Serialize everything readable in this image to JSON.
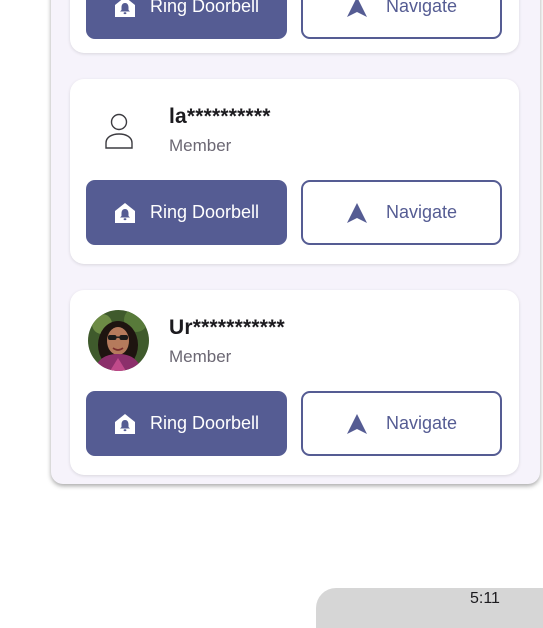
{
  "members": [
    {
      "name": "",
      "role": "",
      "avatar": "none",
      "ring_label": "Ring Doorbell",
      "navigate_label": "Navigate"
    },
    {
      "name": "la**********",
      "role": "Member",
      "avatar": "person-outline-icon",
      "ring_label": "Ring Doorbell",
      "navigate_label": "Navigate"
    },
    {
      "name": "Ur***********",
      "role": "Member",
      "avatar": "photo",
      "ring_label": "Ring Doorbell",
      "navigate_label": "Navigate"
    }
  ],
  "status_bar": {
    "time": "5:11"
  },
  "colors": {
    "primary": "#555c93",
    "panel_bg": "#f6f3fb",
    "card_bg": "#ffffff",
    "text_secondary": "#6b6773"
  }
}
